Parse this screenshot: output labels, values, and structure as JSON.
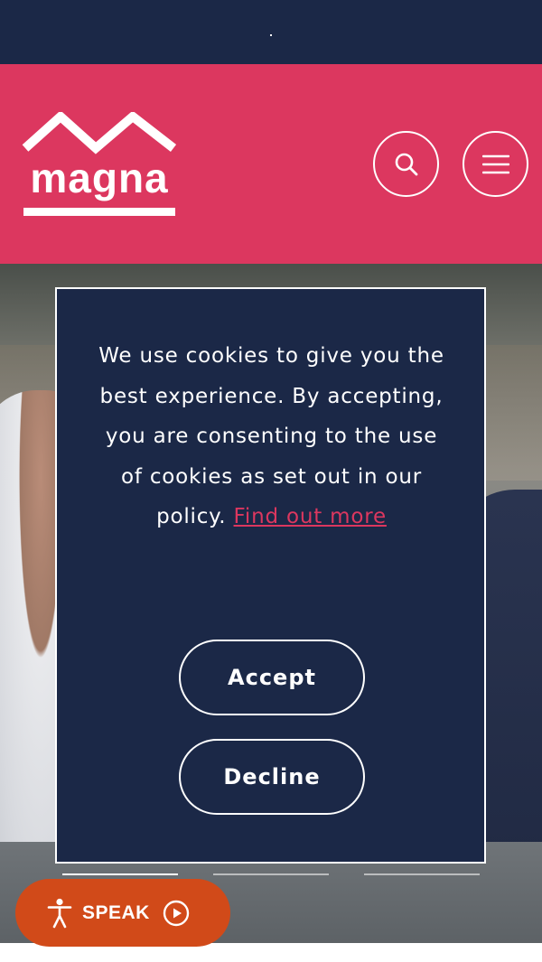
{
  "brand": {
    "logo_text": "magna",
    "colors": {
      "navy": "#1b2847",
      "pink": "#dc375f",
      "orange": "#d14a19"
    }
  },
  "header": {
    "search_icon": "search-icon",
    "menu_icon": "hamburger-menu-icon"
  },
  "cookie_banner": {
    "message": "We use cookies to give you the best experience. By accepting, you are consenting to the use of cookies as set out in our policy.",
    "link_text": "Find out more",
    "accept_label": "Accept",
    "decline_label": "Decline"
  },
  "hero": {
    "slides_count": 3,
    "active_slide": 1
  },
  "speak_widget": {
    "label": "SPEAK",
    "icons": [
      "accessibility-icon",
      "play-icon"
    ]
  }
}
